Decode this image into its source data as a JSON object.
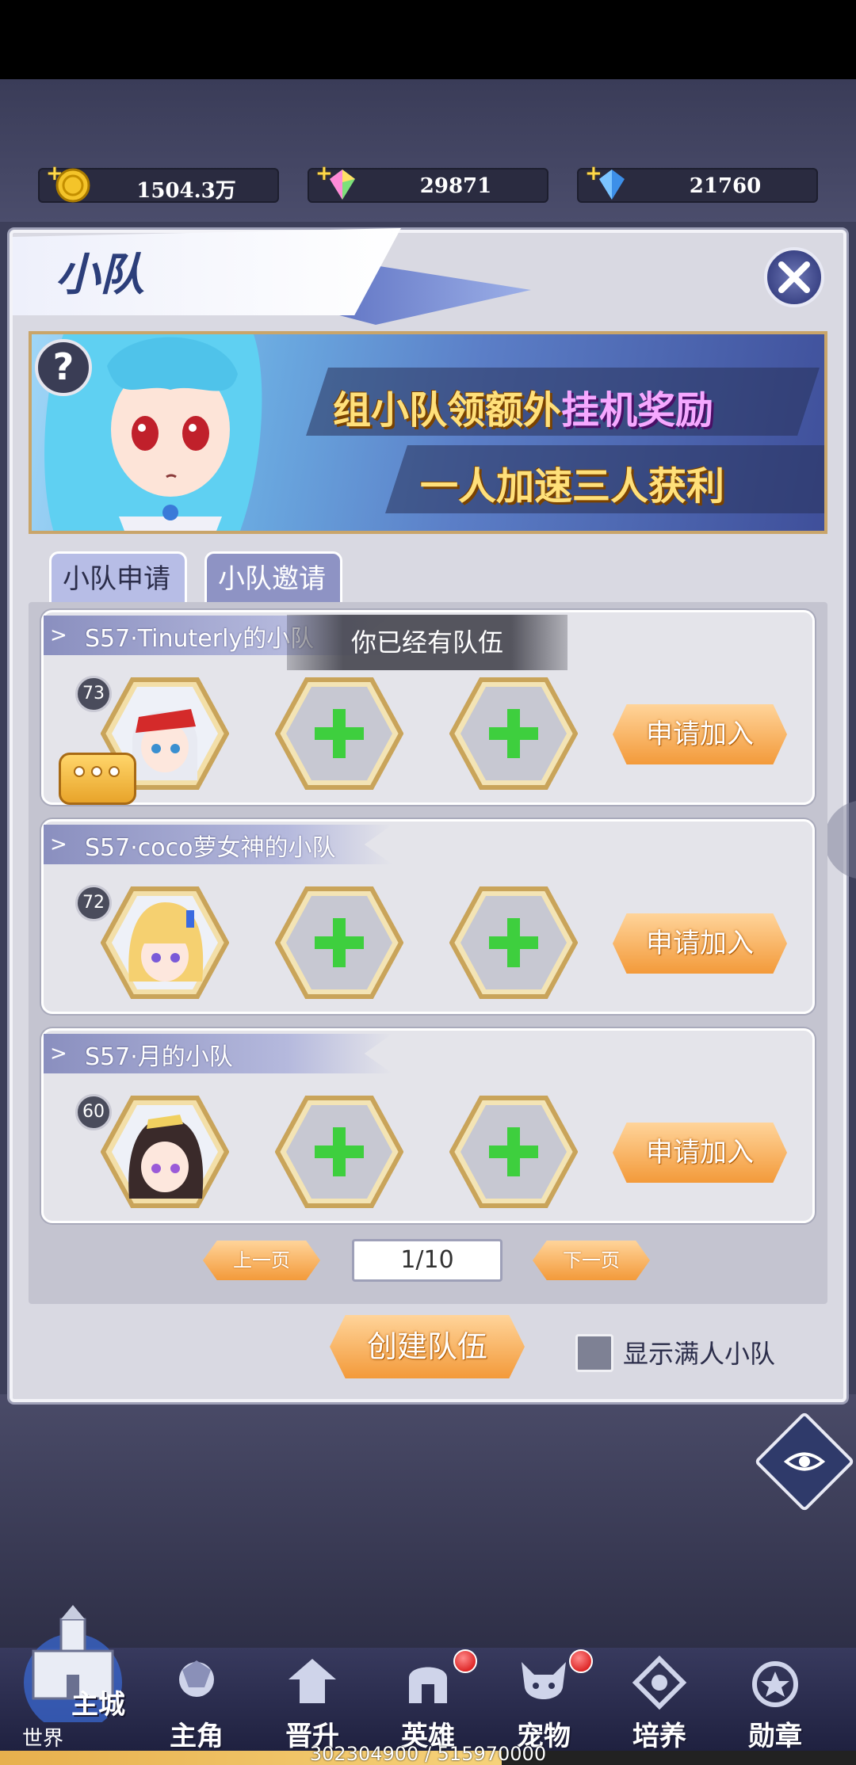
{
  "resources": [
    {
      "icon": "gold-coin-icon",
      "value": "1504.3万"
    },
    {
      "icon": "rainbow-gem-icon",
      "value": "29871"
    },
    {
      "icon": "blue-diamond-icon",
      "value": "21760"
    }
  ],
  "panel": {
    "title": "小队",
    "banner_line1": "组小队领额外",
    "banner_highlight": "挂机奖励",
    "banner_line2": "一人加速三人获利",
    "help_label": "?"
  },
  "tabs": [
    {
      "label": "小队申请",
      "active": true
    },
    {
      "label": "小队邀请",
      "active": false
    }
  ],
  "toast": "你已经有队伍",
  "teams": [
    {
      "name": "S57·Tinuterly的小队",
      "level": "73",
      "apply_label": "申请加入"
    },
    {
      "name": "S57·coco萝女神的小队",
      "level": "72",
      "apply_label": "申请加入"
    },
    {
      "name": "S57·月的小队",
      "level": "60",
      "apply_label": "申请加入"
    }
  ],
  "pagination": {
    "prev": "上一页",
    "current": "1/10",
    "next": "下一页"
  },
  "create_team": "创建队伍",
  "show_full_label": "显示满人小队",
  "nav": {
    "main_city": "主城",
    "world": "世界",
    "items": [
      {
        "label": "主角",
        "icon": "hero-profile-icon",
        "badge": false
      },
      {
        "label": "晋升",
        "icon": "promotion-icon",
        "badge": false
      },
      {
        "label": "英雄",
        "icon": "helmet-icon",
        "badge": true
      },
      {
        "label": "宠物",
        "icon": "pet-icon",
        "badge": true
      },
      {
        "label": "培养",
        "icon": "training-icon",
        "badge": false
      },
      {
        "label": "勋章",
        "icon": "medal-icon",
        "badge": false
      }
    ]
  },
  "progress": {
    "text": "302304900 / 515970000",
    "fraction": 0.5859
  },
  "colors": {
    "accent_orange": "#f39a3a",
    "panel_bg": "#d9d9e2",
    "tab_active": "#b7bde6",
    "plus_green": "#3ecf3e"
  }
}
